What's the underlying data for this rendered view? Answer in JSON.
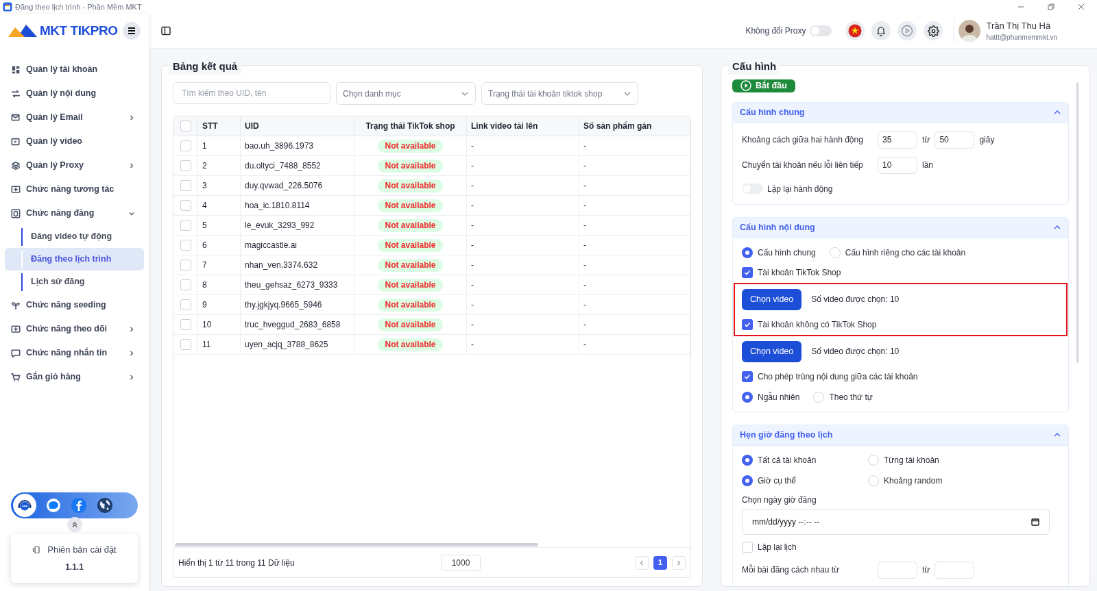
{
  "window": {
    "title": "Đăng theo lịch trình - Phần Mềm MKT"
  },
  "sidebar": {
    "logo": "MKT TIKPRO",
    "items": [
      {
        "label": "Quản lý tài khoản",
        "expandable": false
      },
      {
        "label": "Quản lý nội dung",
        "expandable": false
      },
      {
        "label": "Quản lý Email",
        "expandable": true,
        "expanded": false
      },
      {
        "label": "Quản lý video",
        "expandable": false
      },
      {
        "label": "Quản lý Proxy",
        "expandable": true,
        "expanded": false
      },
      {
        "label": "Chức năng tương tác",
        "expandable": false
      },
      {
        "label": "Chức năng đăng",
        "expandable": true,
        "expanded": true,
        "children": [
          {
            "label": "Đăng video tự động",
            "selected": false
          },
          {
            "label": "Đăng theo lịch trình",
            "selected": true
          },
          {
            "label": "Lịch sử đăng",
            "selected": false
          }
        ]
      },
      {
        "label": "Chức năng seeding",
        "expandable": false
      },
      {
        "label": "Chức năng theo dõi",
        "expandable": true,
        "expanded": false
      },
      {
        "label": "Chức năng nhắn tin",
        "expandable": true,
        "expanded": false
      },
      {
        "label": "Gắn giỏ hàng",
        "expandable": true,
        "expanded": false
      }
    ],
    "version": {
      "label": "Phiên bản cài đặt",
      "value": "1.1.1"
    }
  },
  "header": {
    "proxy_toggle": {
      "label": "Không đổi Proxy",
      "on": false
    },
    "user": {
      "name": "Trần Thị Thu Hà",
      "email": "hattt@phanmemmkt.vn"
    }
  },
  "results": {
    "title": "Bảng kết quả",
    "search": {
      "placeholder": "Tìm kiếm theo UID, tên"
    },
    "filters": [
      {
        "placeholder": "Chọn danh mục"
      },
      {
        "placeholder": "Trạng thái tài khoản tiktok shop"
      }
    ],
    "table": {
      "all_checked": false,
      "columns": [
        "STT",
        "UID",
        "Trạng thái TikTok shop",
        "Link video tải lên",
        "Số sản phẩm gán"
      ],
      "rows": [
        {
          "checked": false,
          "cells": [
            "1",
            "bao.uh_3896.1973",
            "Not available",
            "-",
            "-"
          ]
        },
        {
          "checked": false,
          "cells": [
            "2",
            "du.oltyci_7488_8552",
            "Not available",
            "-",
            "-"
          ]
        },
        {
          "checked": false,
          "cells": [
            "3",
            "duy.qvwad_226.5076",
            "Not available",
            "-",
            "-"
          ]
        },
        {
          "checked": false,
          "cells": [
            "4",
            "hoa_ic.1810.8114",
            "Not available",
            "-",
            "-"
          ]
        },
        {
          "checked": false,
          "cells": [
            "5",
            "le_evuk_3293_992",
            "Not available",
            "-",
            "-"
          ]
        },
        {
          "checked": false,
          "cells": [
            "6",
            "magiccastle.ai",
            "Not available",
            "-",
            "-"
          ]
        },
        {
          "checked": false,
          "cells": [
            "7",
            "nhan_ven.3374.632",
            "Not available",
            "-",
            "-"
          ]
        },
        {
          "checked": false,
          "cells": [
            "8",
            "theu_gehsaz_6273_9333",
            "Not available",
            "-",
            "-"
          ]
        },
        {
          "checked": false,
          "cells": [
            "9",
            "thy.jgkjyq.9665_5946",
            "Not available",
            "-",
            "-"
          ]
        },
        {
          "checked": false,
          "cells": [
            "10",
            "truc_hveggud_2683_6858",
            "Not available",
            "-",
            "-"
          ]
        },
        {
          "checked": false,
          "cells": [
            "11",
            "uyen_acjq_3788_8625",
            "Not available",
            "-",
            "-"
          ]
        }
      ]
    },
    "footer": {
      "summary": "Hiển thị 1 từ 11 trong 11 Dữ liệu",
      "page_size": "1000",
      "pages": [
        {
          "label": "1",
          "selected": true
        }
      ]
    }
  },
  "config": {
    "title": "Cấu hình",
    "start_button": "Bắt đầu",
    "sections": [
      {
        "title": "Cấu hình chung",
        "expanded": true,
        "rows": [
          {
            "kind": "range",
            "label": "Khoảng cách giữa hai hành động",
            "value": "35",
            "sep": "từ",
            "value2": "50",
            "unit": "giây"
          },
          {
            "kind": "number",
            "label": "Chuyển tài khoản nếu lỗi liên tiếp",
            "value": "10",
            "unit": "lần"
          },
          {
            "kind": "toggle",
            "label": "Lặp lại hành động",
            "on": false
          }
        ]
      },
      {
        "title": "Cấu hình nội dung",
        "expanded": true,
        "rows": [
          {
            "kind": "radios",
            "options": [
              {
                "label": "Cấu hình chung",
                "selected": true
              },
              {
                "label": "Cấu hình riêng cho các tài khoản",
                "selected": false
              }
            ]
          },
          {
            "kind": "checkbox",
            "label": "Tài khoản TikTok Shop",
            "checked": true
          },
          {
            "kind": "video_picker",
            "button": "Chọn video",
            "count": "Số video được chọn: 10",
            "highlighted": true
          },
          {
            "kind": "checkbox",
            "label": "Tài khoản không có TikTok Shop",
            "checked": true,
            "highlighted": true
          },
          {
            "kind": "video_picker",
            "button": "Chọn video",
            "count": "Số video được chọn: 10"
          },
          {
            "kind": "checkbox",
            "label": "Cho phép trùng nội dung giữa các tài khoản",
            "checked": true
          },
          {
            "kind": "radios",
            "options": [
              {
                "label": "Ngẫu nhiên",
                "selected": true
              },
              {
                "label": "Theo thứ tự",
                "selected": false
              }
            ]
          }
        ]
      },
      {
        "title": "Hẹn giờ đăng theo lịch",
        "expanded": true,
        "rows": [
          {
            "kind": "radio_columns",
            "options": [
              {
                "label": "Tất cả tài khoản",
                "selected": true
              },
              {
                "label": "Từng tài khoản",
                "selected": false
              }
            ]
          },
          {
            "kind": "radio_columns",
            "options": [
              {
                "label": "Giờ cụ thể",
                "selected": true
              },
              {
                "label": "Khoảng random",
                "selected": false
              }
            ]
          },
          {
            "kind": "label",
            "text": "Chọn ngày giờ đăng"
          },
          {
            "kind": "datetime",
            "placeholder": "mm/dd/yyyy --:-- --"
          },
          {
            "kind": "checkbox",
            "label": "Lặp lại lịch",
            "checked": false
          },
          {
            "kind": "range",
            "label": "Mỗi bài đăng cách nhau từ",
            "sep": "từ"
          }
        ]
      }
    ]
  }
}
